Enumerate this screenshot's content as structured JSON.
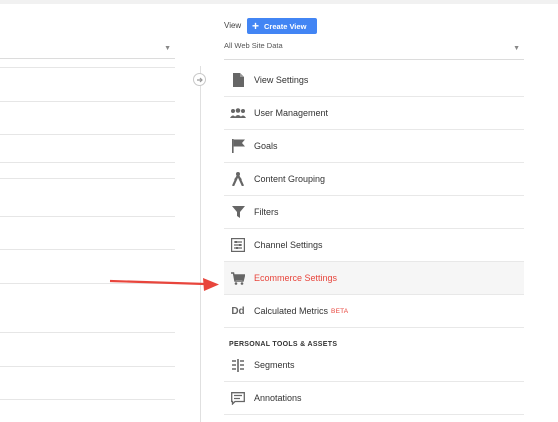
{
  "header": {
    "view_label": "View",
    "create_view_label": "Create View",
    "view_select_value": "All Web Site Data"
  },
  "menu": {
    "items": [
      {
        "label": "View Settings",
        "icon": "document-icon"
      },
      {
        "label": "User Management",
        "icon": "users-icon"
      },
      {
        "label": "Goals",
        "icon": "flag-icon"
      },
      {
        "label": "Content Grouping",
        "icon": "grouping-icon"
      },
      {
        "label": "Filters",
        "icon": "filter-icon"
      },
      {
        "label": "Channel Settings",
        "icon": "channel-icon"
      },
      {
        "label": "Ecommerce Settings",
        "icon": "cart-icon"
      },
      {
        "label": "Calculated Metrics",
        "icon": "dd-icon",
        "badge": "BETA"
      }
    ],
    "section_title": "PERSONAL TOOLS & ASSETS",
    "personal_items": [
      {
        "label": "Segments",
        "icon": "segments-icon"
      },
      {
        "label": "Annotations",
        "icon": "annotation-icon"
      }
    ],
    "dd_icon_text": "Dd"
  },
  "colors": {
    "accent": "#4285f4",
    "highlight_text": "#e8453c",
    "annotation_arrow": "#e8453c"
  }
}
